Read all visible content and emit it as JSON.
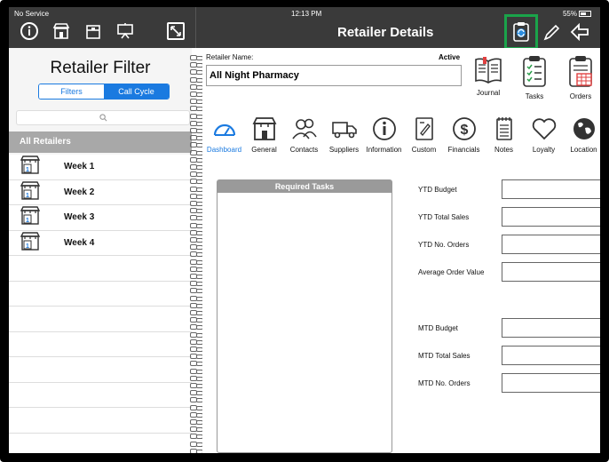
{
  "status": {
    "carrier": "No Service",
    "time": "12:13 PM",
    "battery": "55%"
  },
  "header": {
    "title": "Retailer Details"
  },
  "left": {
    "title": "Retailer Filter",
    "filter_tabs": [
      "Filters",
      "Call Cycle"
    ],
    "selected_tab": "Call Cycle",
    "search_placeholder": "",
    "group_header": "All Retailers",
    "weeks": [
      "Week 1",
      "Week 2",
      "Week 3",
      "Week 4"
    ]
  },
  "right": {
    "retailer_name_label": "Retailer Name:",
    "status": "Active",
    "retailer_name": "All Night Pharmacy",
    "quick_actions": [
      "Journal",
      "Tasks",
      "Orders"
    ],
    "nav_tabs": [
      "Dashboard",
      "General",
      "Contacts",
      "Suppliers",
      "Information",
      "Custom",
      "Financials",
      "Notes",
      "Loyalty",
      "Location"
    ],
    "selected_nav": "Dashboard",
    "required_tasks_title": "Required Tasks",
    "ytd_fields": [
      "YTD Budget",
      "YTD Total Sales",
      "YTD No. Orders",
      "Average Order Value"
    ],
    "mtd_fields": [
      "MTD Budget",
      "MTD Total Sales",
      "MTD No. Orders"
    ]
  },
  "colors": {
    "accent": "#1a7ae0",
    "highlight": "#1aa34a",
    "topbar": "#3a3a3a"
  }
}
